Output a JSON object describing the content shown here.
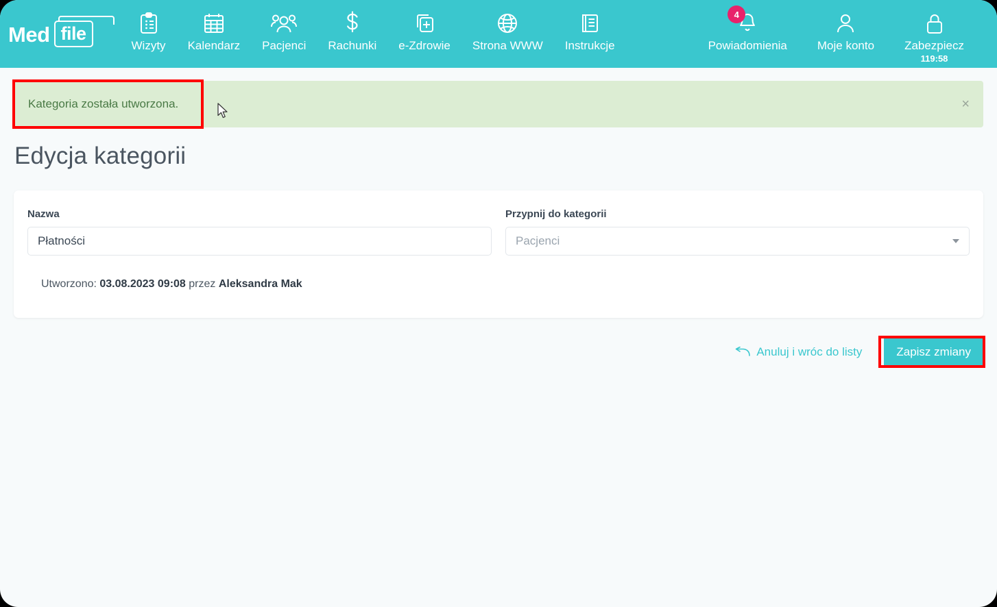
{
  "brand": {
    "part1": "Med",
    "part2": "file"
  },
  "nav": {
    "items": [
      {
        "label": "Wizyty",
        "icon": "clipboard-icon"
      },
      {
        "label": "Kalendarz",
        "icon": "calendar-icon"
      },
      {
        "label": "Pacjenci",
        "icon": "users-icon"
      },
      {
        "label": "Rachunki",
        "icon": "dollar-icon"
      },
      {
        "label": "e-Zdrowie",
        "icon": "medical-file-icon"
      },
      {
        "label": "Strona WWW",
        "icon": "globe-icon"
      },
      {
        "label": "Instrukcje",
        "icon": "book-icon"
      }
    ],
    "right": [
      {
        "label": "Powiadomienia",
        "icon": "bell-icon",
        "badge": "4"
      },
      {
        "label": "Moje konto",
        "icon": "person-icon"
      },
      {
        "label": "Zabezpiecz",
        "icon": "lock-icon",
        "timer": "119:58"
      }
    ]
  },
  "alert": {
    "message": "Kategoria została utworzona.",
    "close_icon": "close-icon",
    "close_label": "×"
  },
  "page": {
    "title": "Edycja kategorii"
  },
  "form": {
    "name": {
      "label": "Nazwa",
      "value": "Płatności",
      "placeholder": "Nazwa"
    },
    "parent": {
      "label": "Przypnij do kategorii",
      "value": "Pacjenci",
      "caret_icon": "chevron-down-icon"
    },
    "meta": {
      "prefix": "Utworzono:",
      "datetime": "03.08.2023 09:08",
      "middle": "przez",
      "author": "Aleksandra Mak"
    }
  },
  "actions": {
    "cancel_label": "Anuluj i wróc do listy",
    "cancel_icon": "arrow-back-icon",
    "save_label": "Zapisz zmiany"
  },
  "colors": {
    "brand_teal": "#3ac7ce",
    "alert_green_bg": "#dcedd3",
    "alert_green_text": "#4a7a46",
    "badge_pink": "#e8226b",
    "annotation_red": "#ff0000",
    "page_bg": "#f7fafb"
  }
}
